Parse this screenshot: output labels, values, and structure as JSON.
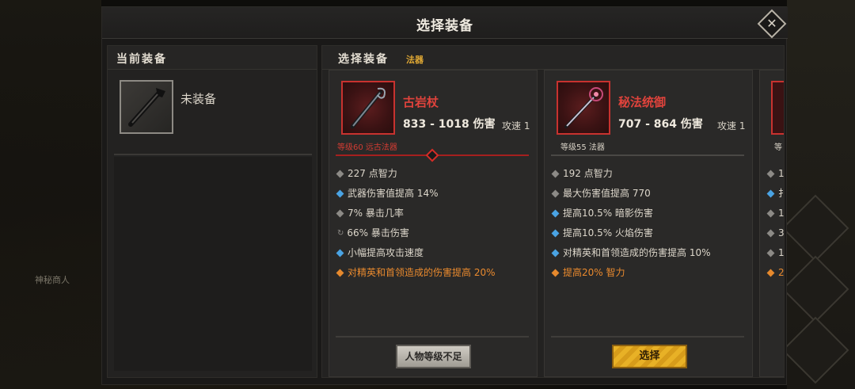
{
  "dialog": {
    "title": "选择装备",
    "close_glyph": "✕"
  },
  "current_panel": {
    "header": "当前装备",
    "slot_label": "未装备"
  },
  "select_panel": {
    "header": "选择装备",
    "type_tag": "法器"
  },
  "cards": [
    {
      "name": "古岩杖",
      "damage": "833 - 1018 伤害",
      "speed": "攻速 1",
      "level": "等级60 远古法器",
      "stats": [
        {
          "bullet": "gray",
          "text": "227 点智力"
        },
        {
          "bullet": "blue",
          "text": "武器伤害值提高 14%"
        },
        {
          "bullet": "gray",
          "text": "7% 暴击几率"
        },
        {
          "bullet": "reload",
          "text": "66% 暴击伤害"
        },
        {
          "bullet": "blue",
          "text": "小幅提高攻击速度"
        },
        {
          "bullet": "orange",
          "text": "对精英和首领造成的伤害提高 20%"
        }
      ],
      "button": "人物等级不足"
    },
    {
      "name": "秘法统御",
      "damage": "707 - 864 伤害",
      "speed": "攻速 1",
      "level": "等级55 法器",
      "stats": [
        {
          "bullet": "gray",
          "text": "192 点智力"
        },
        {
          "bullet": "gray",
          "text": "最大伤害值提高 770"
        },
        {
          "bullet": "blue",
          "text": "提高10.5% 暗影伤害"
        },
        {
          "bullet": "blue",
          "text": "提高10.5% 火焰伤害"
        },
        {
          "bullet": "blue",
          "text": "对精英和首领造成的伤害提高 10%"
        },
        {
          "bullet": "orange",
          "text": "提高20% 智力"
        }
      ],
      "button": "选择"
    }
  ],
  "card3": {
    "level": "等",
    "stats": [
      {
        "bullet": "gray",
        "text": "1"
      },
      {
        "bullet": "blue",
        "text": "扌"
      },
      {
        "bullet": "gray",
        "text": "1"
      },
      {
        "bullet": "gray",
        "text": "3"
      },
      {
        "bullet": "gray",
        "text": "1"
      },
      {
        "bullet": "orange",
        "text": "2"
      }
    ]
  },
  "background": {
    "npc_label": "神秘商人"
  }
}
